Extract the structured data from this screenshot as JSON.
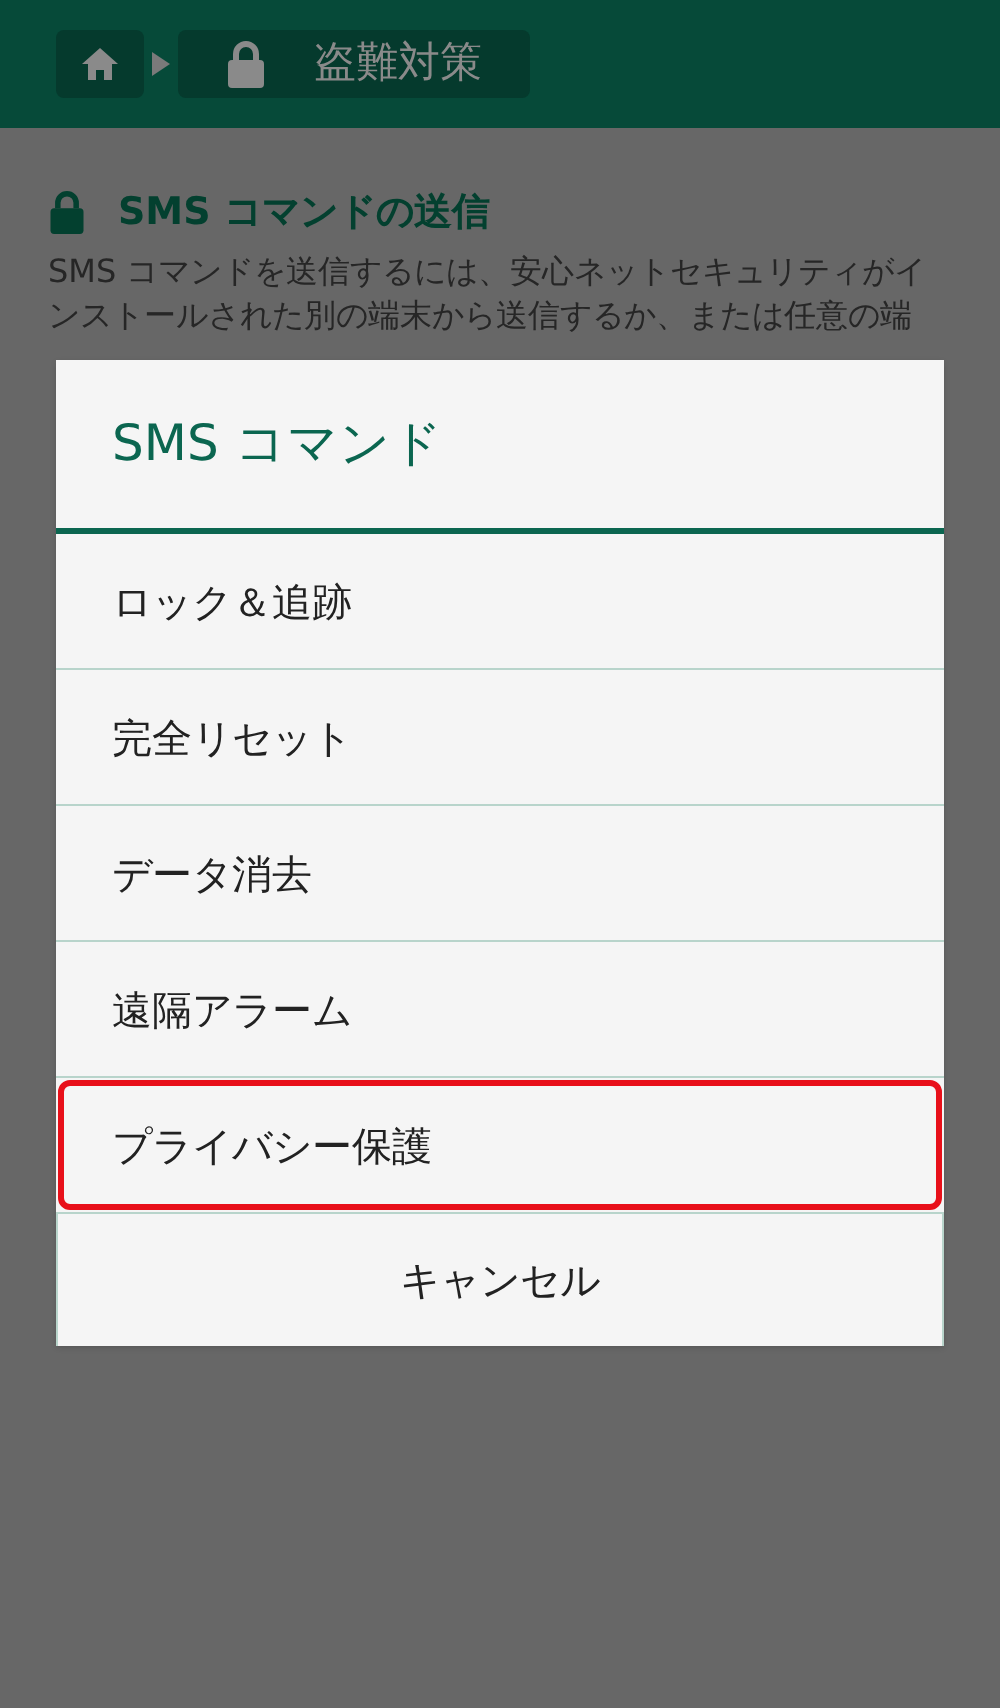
{
  "header": {
    "breadcrumb": [
      {
        "kind": "home"
      },
      {
        "kind": "page",
        "label": "盗難対策"
      }
    ]
  },
  "section": {
    "title": "SMS コマンドの送信",
    "body": "SMS コマンドを送信するには、安心ネットセキュリティがインストールされた別の端末から送信するか、または任意の端"
  },
  "dialog": {
    "title": "SMS コマンド",
    "items": [
      {
        "label": "ロック＆追跡",
        "selected": false
      },
      {
        "label": "完全リセット",
        "selected": false
      },
      {
        "label": "データ消去",
        "selected": false
      },
      {
        "label": "遠隔アラーム",
        "selected": false
      },
      {
        "label": "プライバシー保護",
        "selected": true
      }
    ],
    "cancel": "キャンセル"
  }
}
